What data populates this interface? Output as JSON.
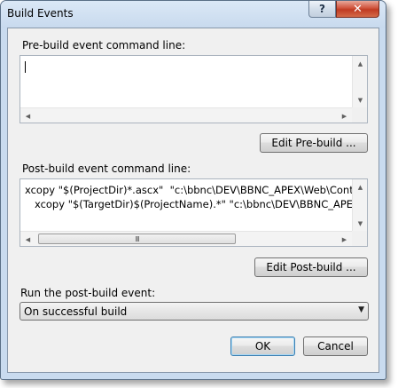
{
  "window": {
    "title": "Build Events"
  },
  "titlebar": {
    "help_glyph": "?",
    "close_glyph": "✕"
  },
  "prebuild": {
    "label": "Pre-build event command line:",
    "text": "",
    "edit_button": "Edit Pre-build ..."
  },
  "postbuild": {
    "label": "Post-build event command line:",
    "text": "xcopy \"$(ProjectDir)*.ascx\"  \"c:\\bbnc\\DEV\\BBNC_APEX\\Web\\Content\\\n   xcopy \"$(TargetDir)$(ProjectName).*\" \"c:\\bbnc\\DEV\\BBNC_APEX\\V",
    "edit_button": "Edit Post-build ..."
  },
  "run": {
    "label": "Run the post-build event:",
    "selected": "On successful build"
  },
  "footer": {
    "ok": "OK",
    "cancel": "Cancel"
  },
  "scroll": {
    "grip": "III"
  },
  "icons": {
    "scroll_up": "up-arrow-icon",
    "scroll_down": "down-arrow-icon",
    "scroll_left": "left-arrow-icon",
    "scroll_right": "right-arrow-icon",
    "dropdown": "chevron-down-icon",
    "help": "help-icon",
    "close": "close-icon"
  },
  "colors": {
    "frame": "#c9dbef",
    "client": "#f0f0f0",
    "close_button": "#c8432b",
    "default_button_border": "#3c7fb1"
  }
}
